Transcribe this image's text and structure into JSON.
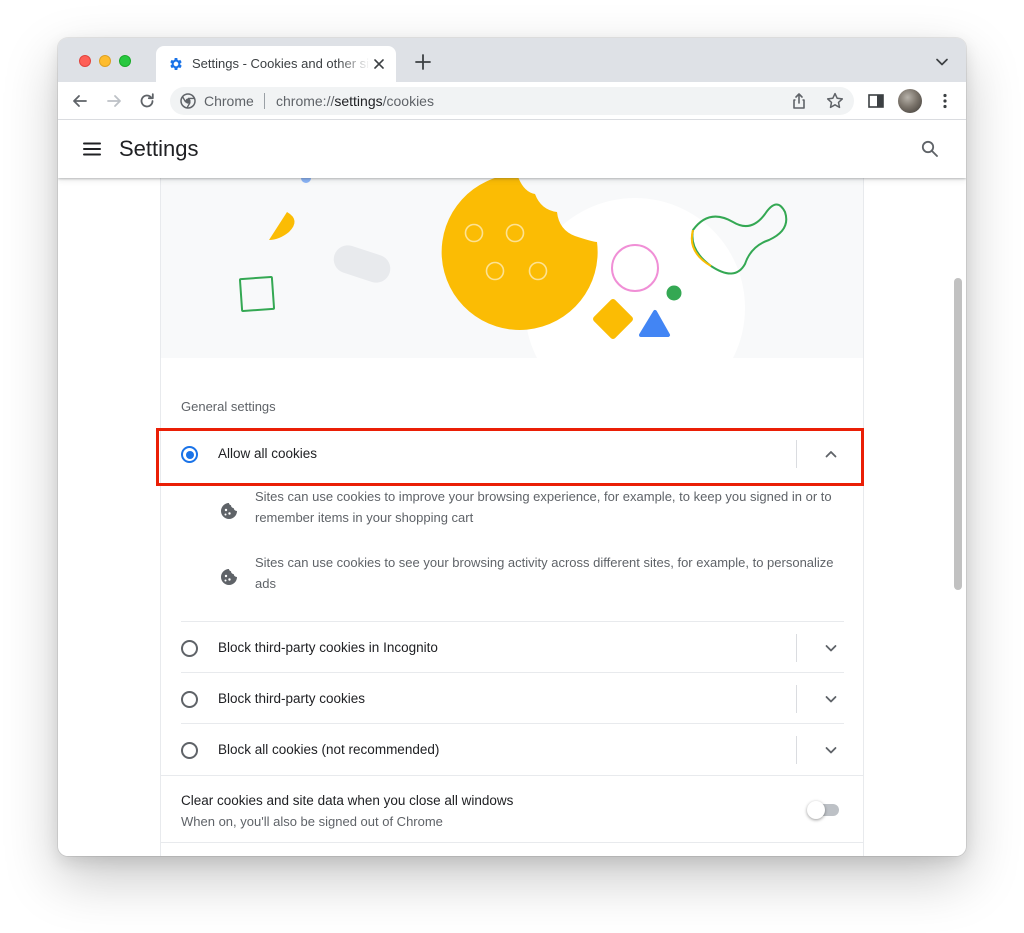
{
  "browser": {
    "tab": {
      "title": "Settings - Cookies and other site data"
    },
    "omnibox": {
      "chip": "Chrome",
      "url_prefix": "chrome://",
      "url_host": "settings",
      "url_path": "/cookies"
    },
    "icons": [
      "settings-favicon-icon",
      "close-icon",
      "plus-icon",
      "chevron-down-icon",
      "back-arrow-icon",
      "forward-arrow-icon",
      "reload-icon",
      "chrome-logo-icon",
      "share-icon",
      "star-icon",
      "side-panel-icon",
      "kebab-menu-icon"
    ]
  },
  "settings": {
    "title": "Settings",
    "section_label": "General settings",
    "options": [
      {
        "label": "Allow all cookies",
        "selected": true,
        "expanded": true,
        "details": [
          "Sites can use cookies to improve your browsing experience, for example, to keep you signed in or to remember items in your shopping cart",
          "Sites can use cookies to see your browsing activity across different sites, for example, to personalize ads"
        ]
      },
      {
        "label": "Block third-party cookies in Incognito",
        "selected": false,
        "expanded": false
      },
      {
        "label": "Block third-party cookies",
        "selected": false,
        "expanded": false
      },
      {
        "label": "Block all cookies (not recommended)",
        "selected": false,
        "expanded": false
      }
    ],
    "clear_on_exit": {
      "title": "Clear cookies and site data when you close all windows",
      "subtitle": "When on, you'll also be signed out of Chrome",
      "enabled": false
    }
  },
  "colors": {
    "accent_blue": "#1a73e8",
    "highlight_red": "#ea1f06",
    "cookie_yellow": "#fbbc04",
    "green": "#34a853",
    "pink": "#f08fd6"
  }
}
